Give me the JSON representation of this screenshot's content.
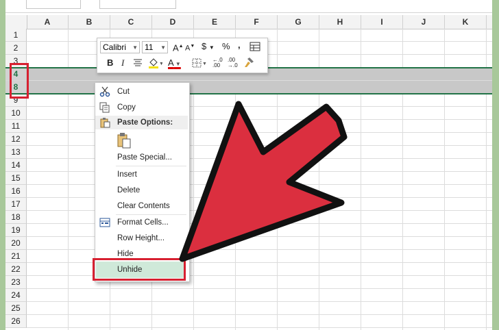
{
  "columns": [
    "A",
    "B",
    "C",
    "D",
    "E",
    "F",
    "G",
    "H",
    "I",
    "J",
    "K"
  ],
  "rows": [
    "1",
    "2",
    "3",
    "4",
    "8",
    "9",
    "10",
    "11",
    "12",
    "13",
    "14",
    "15",
    "16",
    "17",
    "18",
    "19",
    "20",
    "21",
    "22",
    "23",
    "24",
    "25",
    "26"
  ],
  "mini_toolbar": {
    "font_name": "Calibri",
    "font_size": "11",
    "grow_font": "A",
    "shrink_font": "A",
    "currency": "$",
    "percent": "%",
    "comma": ",",
    "bold": "B",
    "italic": "I",
    "font_color": "A",
    "decrease_decimal": "←.0 .00",
    "increase_decimal": ".00 →.0"
  },
  "context_menu": {
    "cut": "Cut",
    "copy": "Copy",
    "paste_options": "Paste Options:",
    "paste_special": "Paste Special...",
    "insert": "Insert",
    "delete": "Delete",
    "clear_contents": "Clear Contents",
    "format_cells": "Format Cells...",
    "row_height": "Row Height...",
    "hide": "Hide",
    "unhide": "Unhide"
  },
  "colors": {
    "highlight_red": "#d72030",
    "excel_green": "#217346",
    "selection_gray": "#c8c8c8",
    "unhide_highlight": "#cfe9d9"
  },
  "icons": [
    "cut-icon",
    "copy-icon",
    "paste-icon",
    "clipboard-icon",
    "format-cells-icon",
    "arrow-icon"
  ]
}
